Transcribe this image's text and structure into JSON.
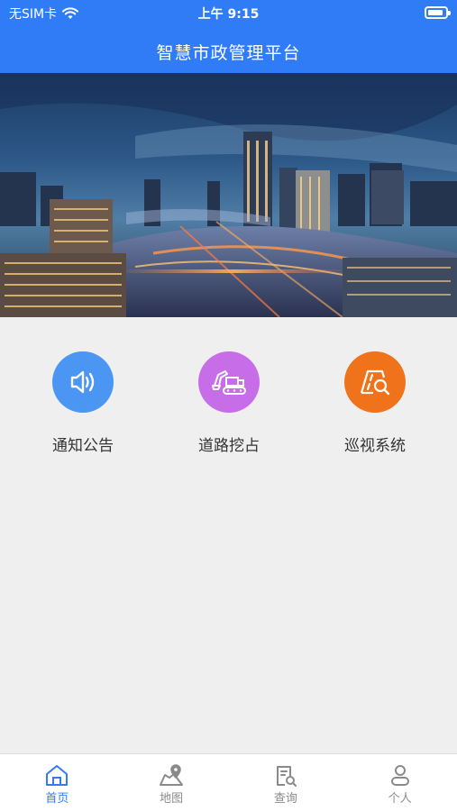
{
  "status": {
    "carrier": "无SIM卡",
    "time": "上午 9:15",
    "battery_level": 0.9
  },
  "header": {
    "title": "智慧市政管理平台"
  },
  "banner": {
    "alt": ""
  },
  "menu": [
    {
      "label": "通知公告",
      "icon": "speaker-icon",
      "color": "#4a96f2"
    },
    {
      "label": "道路挖占",
      "icon": "excavator-icon",
      "color": "#c76de8"
    },
    {
      "label": "巡视系统",
      "icon": "road-inspect-icon",
      "color": "#f0731b"
    }
  ],
  "tabs": [
    {
      "label": "首页",
      "icon": "home-icon",
      "active": true
    },
    {
      "label": "地图",
      "icon": "map-icon",
      "active": false
    },
    {
      "label": "查询",
      "icon": "search-doc-icon",
      "active": false
    },
    {
      "label": "个人",
      "icon": "person-icon",
      "active": false
    }
  ],
  "colors": {
    "primary": "#2f7cf6",
    "tab_active": "#2f7cf6",
    "tab_inactive": "#8a8a8a"
  }
}
